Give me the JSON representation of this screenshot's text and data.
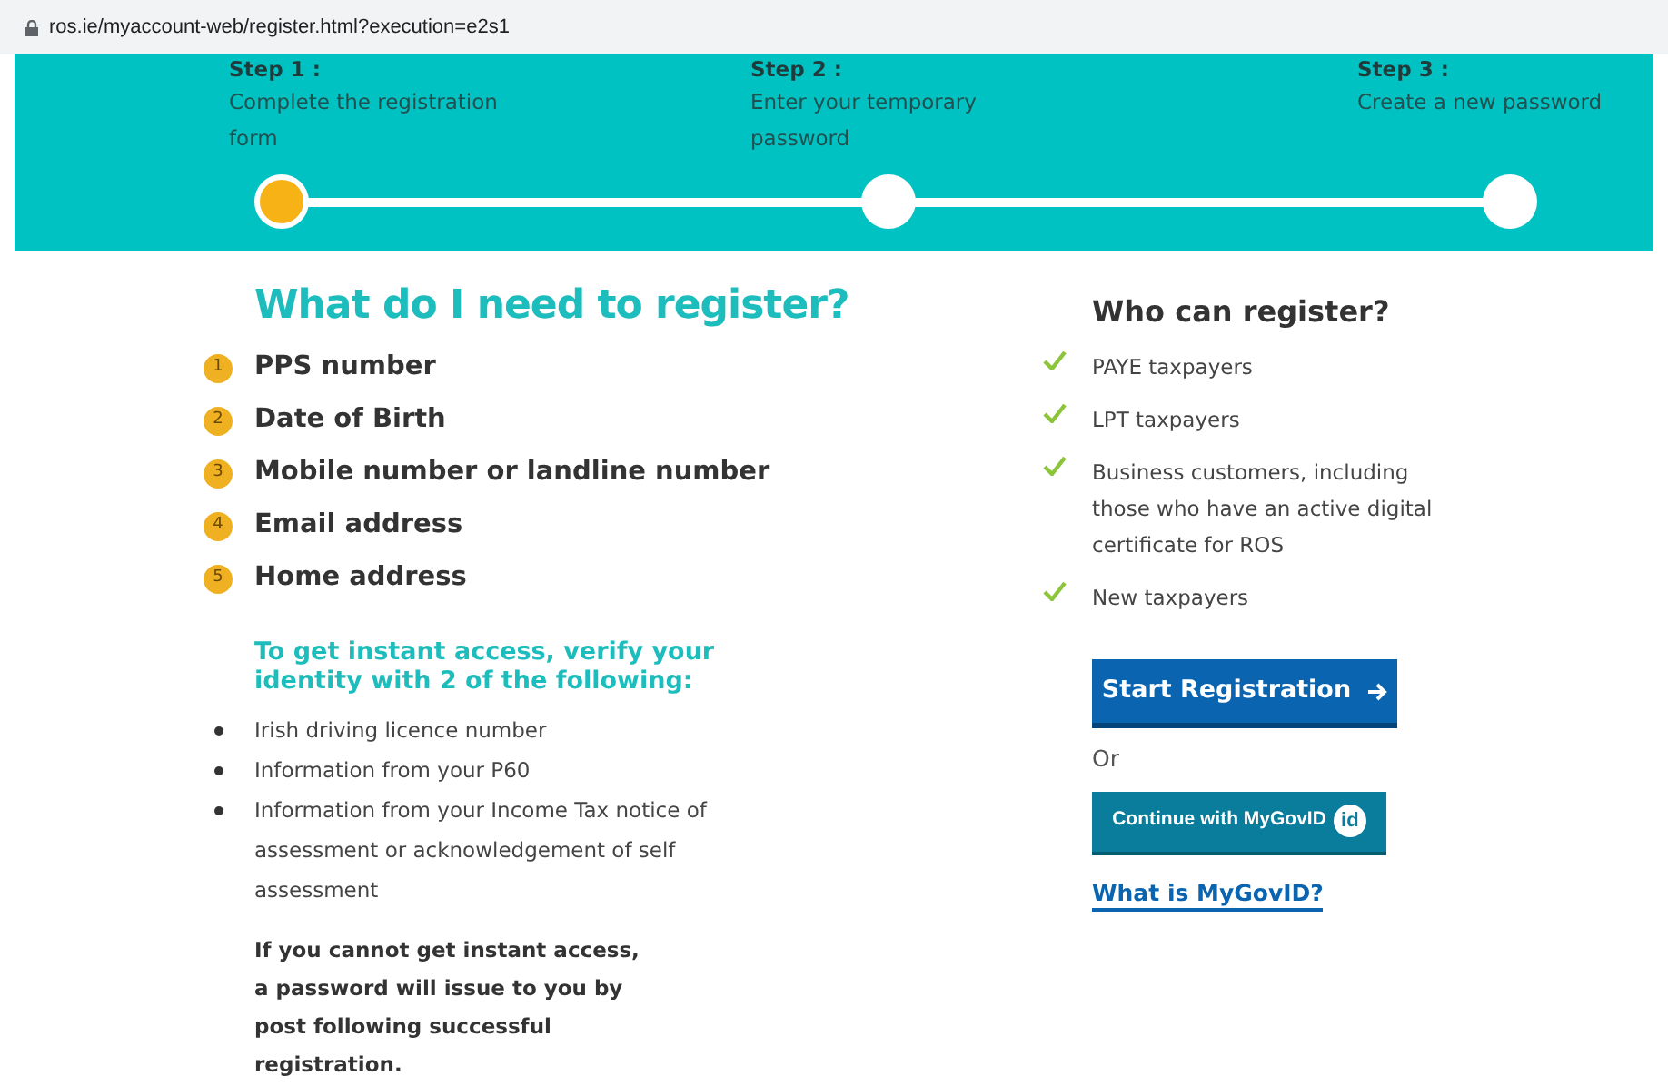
{
  "address_bar": {
    "url": "ros.ie/myaccount-web/register.html?execution=e2s1"
  },
  "steps": [
    {
      "label": "Step 1 :",
      "description": "Complete the registration form",
      "selected": true
    },
    {
      "label": "Step 2 :",
      "description": "Enter your temporary password",
      "selected": false
    },
    {
      "label": "Step 3 :",
      "description": "Create a new password",
      "selected": false
    }
  ],
  "requirements": {
    "title": "What do I need to register?",
    "items": [
      {
        "number": "1",
        "text": "PPS number"
      },
      {
        "number": "2",
        "text": "Date of Birth"
      },
      {
        "number": "3",
        "text": "Mobile number or landline number"
      },
      {
        "number": "4",
        "text": "Email address"
      },
      {
        "number": "5",
        "text": "Home address"
      }
    ]
  },
  "verify": {
    "title": "To get instant access, verify your identity with 2 of the following:",
    "items": [
      "Irish driving licence number",
      "Information from your P60",
      "Information from your Income Tax notice of assessment or acknowledgement of self assessment"
    ],
    "note": "If you cannot get instant access, a password will issue to you by post following successful registration."
  },
  "who": {
    "title": "Who can register?",
    "items": [
      "PAYE taxpayers",
      "LPT taxpayers",
      "Business customers, including those who have an active digital certificate for ROS",
      "New taxpayers"
    ]
  },
  "start_button": "Start Registration",
  "or": "Or",
  "mygovid_button": {
    "label": "Continue with MyGovID",
    "badge": "id"
  },
  "link": "What is MyGovID?"
}
